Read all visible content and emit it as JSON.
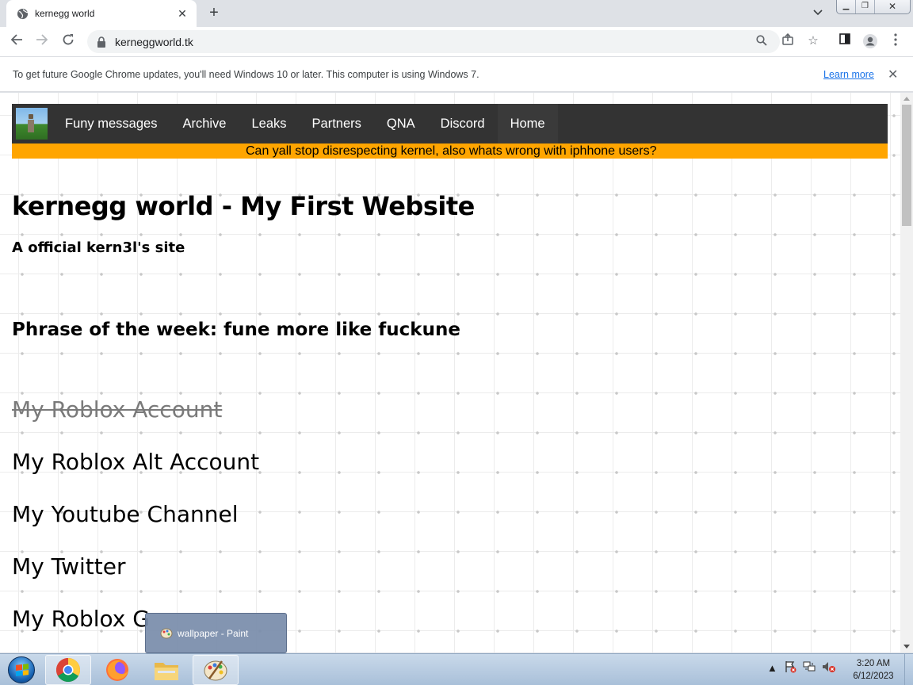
{
  "browser": {
    "tab_title": "kernegg world",
    "url": "kerneggworld.tk",
    "infobar_message": "To get future Google Chrome updates, you'll need Windows 10 or later. This computer is using Windows 7.",
    "infobar_link": "Learn more"
  },
  "site": {
    "nav": [
      "Funy messages",
      "Archive",
      "Leaks",
      "Partners",
      "QNA",
      "Discord",
      "Home"
    ],
    "marquee": "Can yall stop disrespecting kernel, also whats wrong with iphhone users?",
    "title": "kernegg world - My First Website",
    "subtitle": "A official kern3l's site",
    "phrase": "Phrase of the week: fune more like fuckune",
    "links": [
      {
        "label": "My Roblox Account",
        "struck": true
      },
      {
        "label": "My Roblox Alt Account",
        "struck": false
      },
      {
        "label": "My Youtube Channel",
        "struck": false
      },
      {
        "label": "My Twitter",
        "struck": false
      },
      {
        "label": "My Roblox G",
        "struck": false
      }
    ]
  },
  "taskbar": {
    "preview_label": "wallpaper - Paint",
    "time": "3:20 AM",
    "date": "6/12/2023"
  },
  "colors": {
    "nav_bg": "#333333",
    "marquee_bg": "#ffa500",
    "link_blue": "#1a73e8"
  }
}
